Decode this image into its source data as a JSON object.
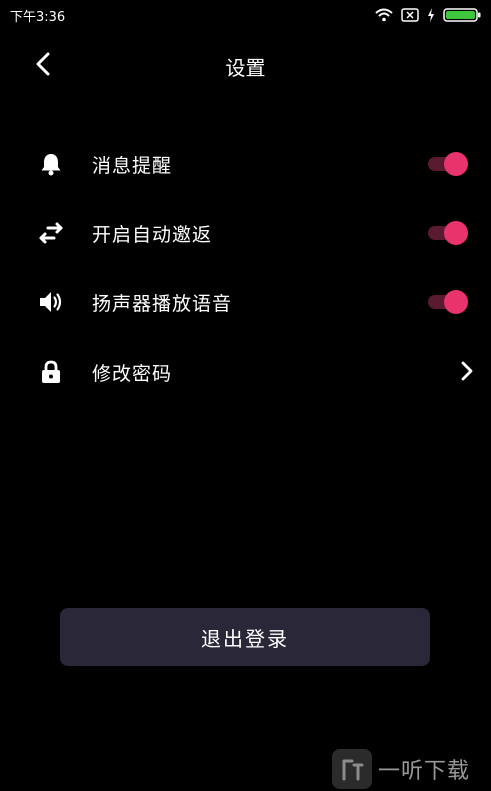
{
  "status_bar": {
    "time": "下午3:36"
  },
  "header": {
    "title": "设置"
  },
  "settings": [
    {
      "label": "消息提醒",
      "icon": "bell-icon",
      "control": "toggle",
      "on": true
    },
    {
      "label": "开启自动邀返",
      "icon": "swap-arrows-icon",
      "control": "toggle",
      "on": true
    },
    {
      "label": "扬声器播放语音",
      "icon": "speaker-icon",
      "control": "toggle",
      "on": true
    },
    {
      "label": "修改密码",
      "icon": "lock-icon",
      "control": "chevron"
    }
  ],
  "logout_label": "退出登录",
  "watermark": {
    "text": "一听下载"
  },
  "colors": {
    "background": "#000000",
    "accent": "#e8336d",
    "button_bg": "#2a2738"
  }
}
